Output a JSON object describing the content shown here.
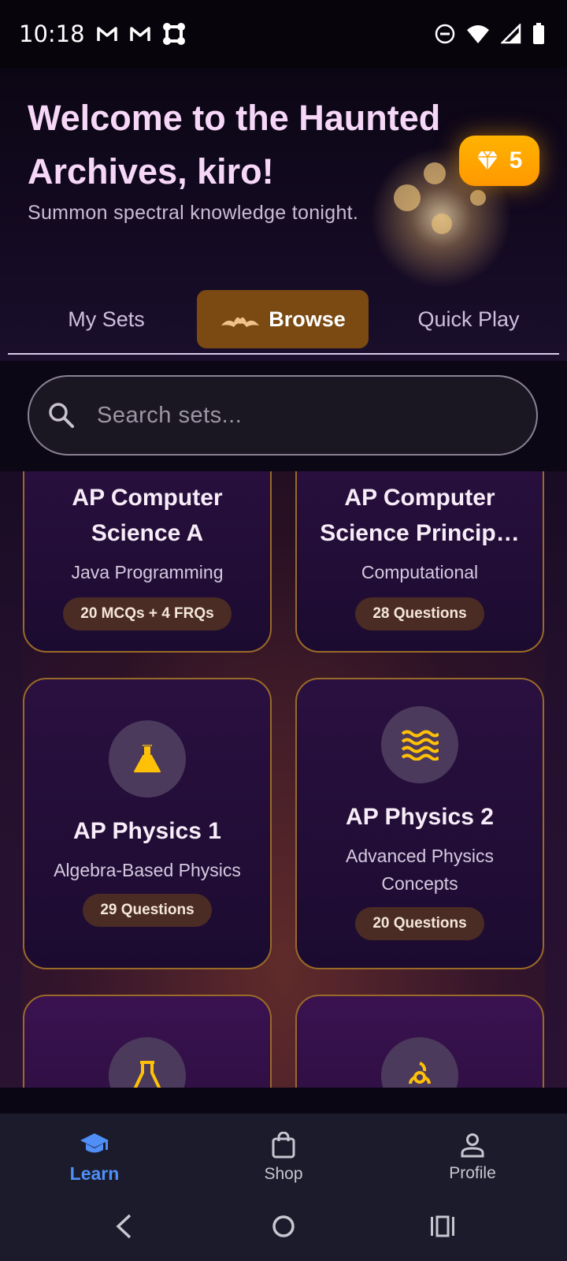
{
  "status_bar": {
    "time": "10:18"
  },
  "header": {
    "title": "Welcome to the Haunted Archives, kiro!",
    "subtitle": "Summon spectral knowledge tonight.",
    "gems": "5"
  },
  "tabs": [
    {
      "label": "My Sets"
    },
    {
      "label": "Browse",
      "selected": true
    },
    {
      "label": "Quick Play"
    }
  ],
  "search": {
    "placeholder": "Search sets..."
  },
  "sets": [
    {
      "title": "AP Computer Science A",
      "subtitle": "Java Programming",
      "count": "20 MCQs + 4 FRQs"
    },
    {
      "title": "AP Computer Science Princip…",
      "subtitle": "Computational",
      "count": "28 Questions"
    },
    {
      "title": "AP Physics 1",
      "subtitle": "Algebra-Based Physics",
      "count": "29 Questions",
      "icon": "flask-icon"
    },
    {
      "title": "AP Physics 2",
      "subtitle": "Advanced Physics Concepts",
      "count": "20 Questions",
      "icon": "waves-icon"
    },
    {
      "icon": "beaker-icon"
    },
    {
      "icon": "biohazard-icon"
    }
  ],
  "bottom_nav": [
    {
      "label": "Learn",
      "icon": "school-icon",
      "active": true
    },
    {
      "label": "Shop",
      "icon": "shopping-bag-icon"
    },
    {
      "label": "Profile",
      "icon": "person-icon"
    }
  ],
  "colors": {
    "accent": "#7a4a12",
    "gem": "#ffa000",
    "active_nav": "#4f8ff7",
    "card_border": "#9a6a28"
  }
}
